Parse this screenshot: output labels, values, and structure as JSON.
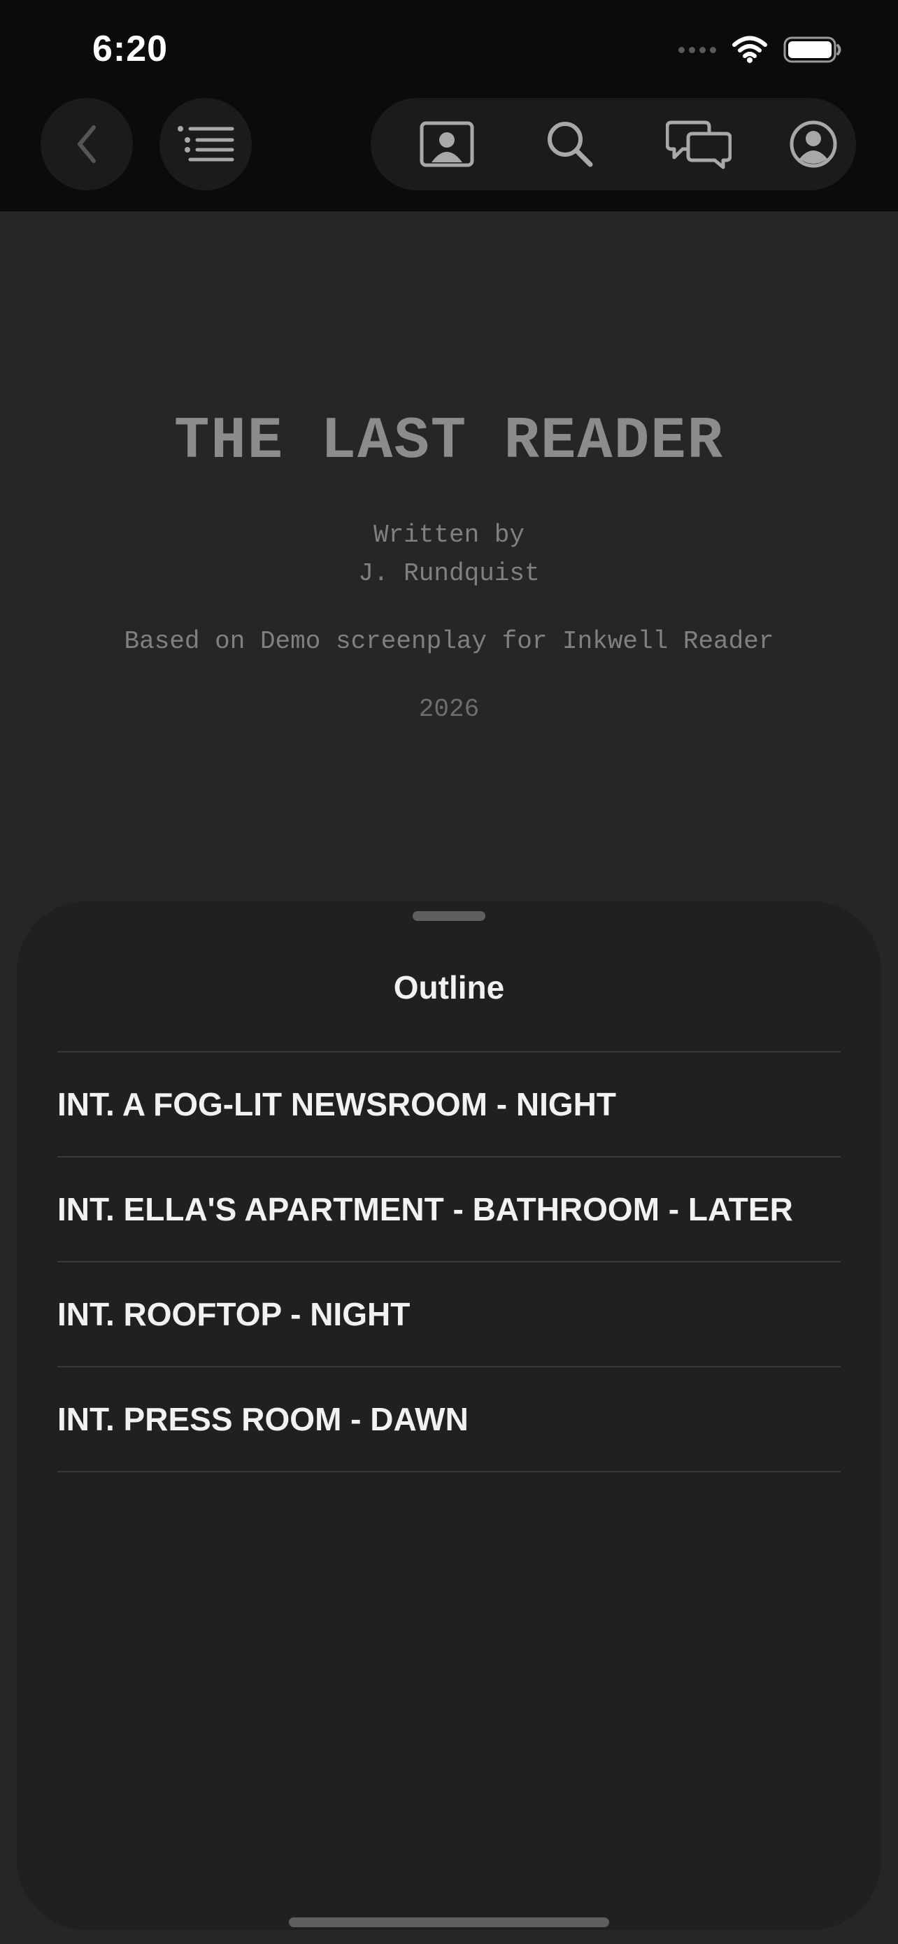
{
  "status_bar": {
    "time": "6:20"
  },
  "toolbar": {
    "back_icon": "chevron-left-icon",
    "outline_icon": "list-icon",
    "actions": [
      "portrait-icon",
      "search-icon",
      "chat-bubbles-icon",
      "account-icon"
    ]
  },
  "script": {
    "title": "THE LAST READER",
    "written_by": "Written by",
    "author": "J. Rundquist",
    "based_on": "Based on Demo screenplay for Inkwell Reader",
    "year": "2026"
  },
  "outline": {
    "title": "Outline",
    "scenes": [
      "INT. A FOG-LIT NEWSROOM - NIGHT",
      "INT. ELLA'S APARTMENT - BATHROOM - LATER",
      "INT. ROOFTOP - NIGHT",
      "INT. PRESS ROOM - DAWN"
    ]
  },
  "colors": {
    "background": "#262626",
    "toolbar": "#0b0b0b",
    "sheet": "#202020",
    "text_primary": "#f2f2f2",
    "text_muted": "#8c8c8c"
  }
}
